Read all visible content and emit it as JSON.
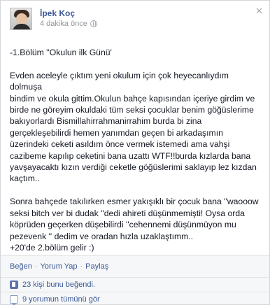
{
  "post": {
    "author": "İpek Koç",
    "time": "4 dakika önce",
    "privacy_icon": "globe-icon",
    "content": "-1.Bölüm ''Okulun ilk Günü'\n\nEvden aceleyle çıktım yeni okulum için çok heyecanlıydım dolmuşa\nbindim ve okula gittim.Okulun bahçe kapısından içeriye girdim ve\nbirde ne göreyim okuldaki tüm seksi çocuklar benim göğüslerime\nbakıyorlardı Bismillahirrahmanirrahim burda bi zina\ngerçekleşebilirdi hemen yanımdan geçen bi arkadaşımın\nüzerindeki ceketi asıldım önce vermek istemedi ama vahşi\ncazibeme kapılıp ceketini bana uzattı WTF!!burda kızlarda bana\nyavşayacaktı kızın verdiği ceketle göğüslerimi saklayıp lez kızdan\nkaçtım..\n\nSonra bahçede takılırken esmer yakışıklı bir çocuk bana ''waooow\nseksi bitch ver bi dudak ''dedi ahireti düşünmemişti! Oysa orda\nköprüden geçerken düşebilirdi ''cehennemi düşünmüyon mu\npezevenk '' dedim ve oradan hızla uzaklaştımm..\n+20'de 2.bölüm gelir :)"
  },
  "actions": {
    "like": "Beğen",
    "comment": "Yorum Yap",
    "share": "Paylaş",
    "separator": "·"
  },
  "likes": {
    "icon": "thumbs-up-icon",
    "text": "23 kişi bunu beğendi."
  },
  "comments": {
    "icon": "comment-icon",
    "text": "9 yorumun tümünü gör"
  },
  "colors": {
    "link": "#3b5998",
    "meta": "#90949c",
    "footer_bg": "#f6f7f9"
  }
}
